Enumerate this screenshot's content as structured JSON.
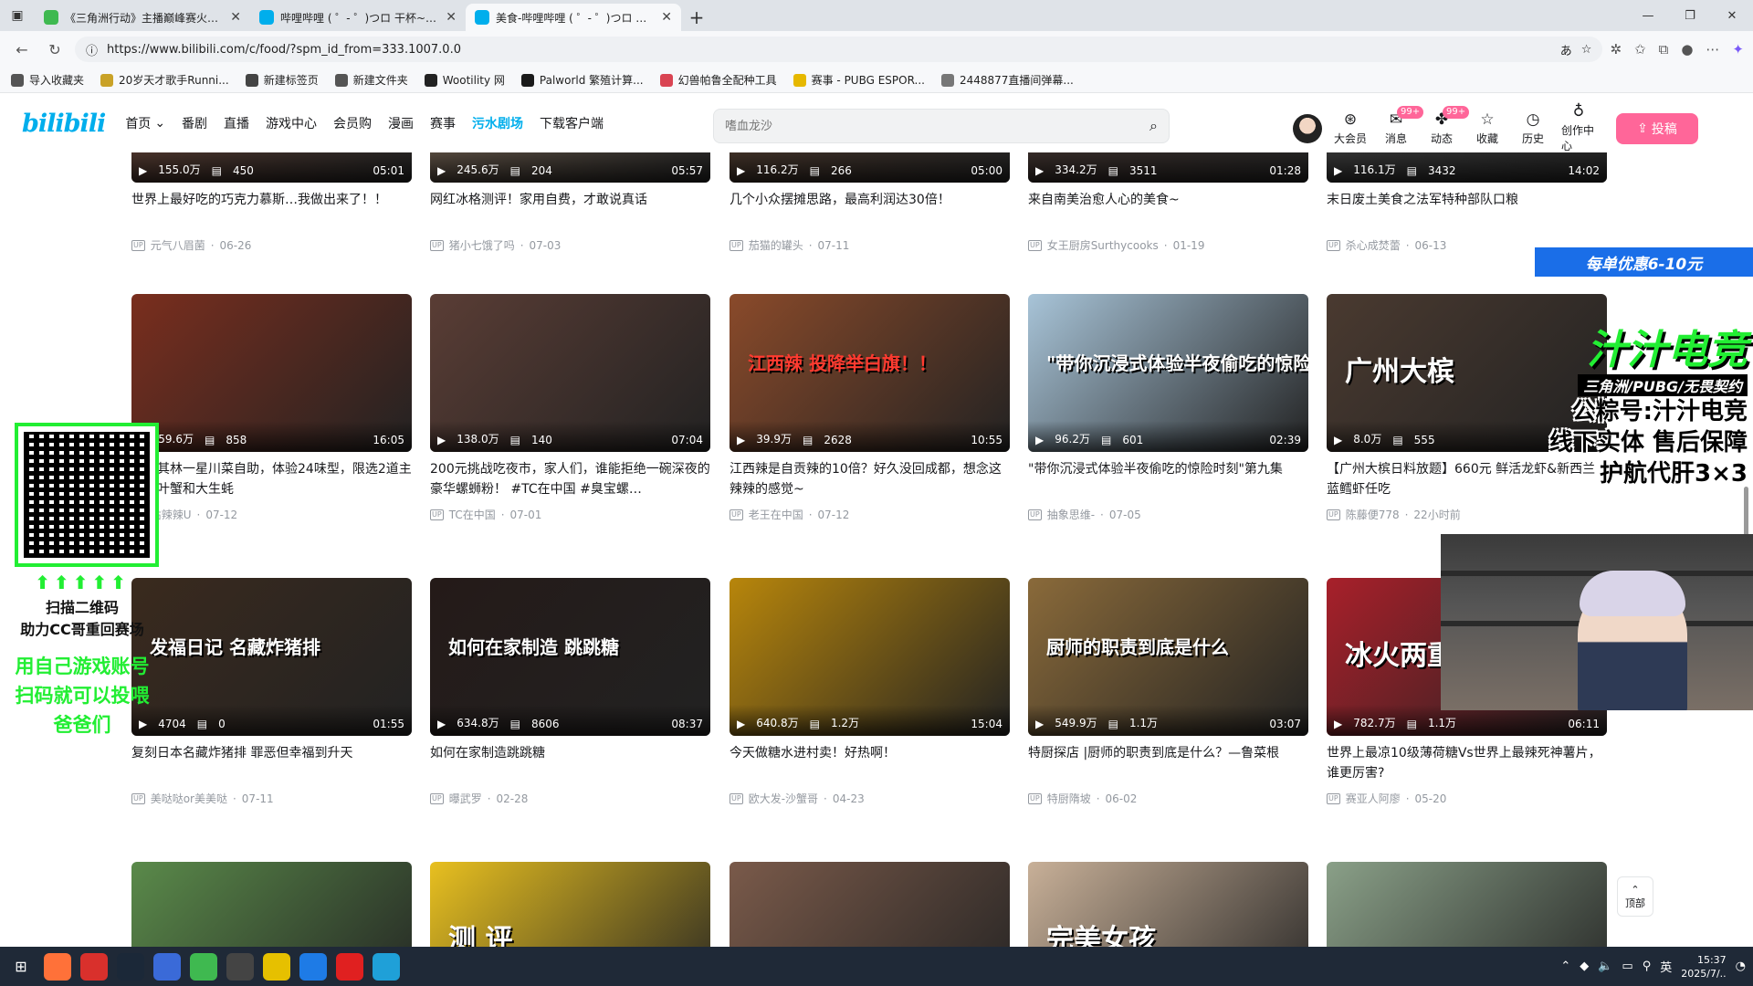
{
  "browser": {
    "tabs": [
      {
        "label": "《三角洲行动》主播巅峰赛火热进行中",
        "icon_color": "#3fb950",
        "active": false
      },
      {
        "label": "哔哩哔哩 ( ゜- ゜)つロ 干杯~-bilibili",
        "icon_color": "#00aeec",
        "active": false
      },
      {
        "label": "美食-哔哩哔哩 ( ゜- ゜)つロ 干杯~",
        "icon_color": "#00aeec",
        "active": true
      }
    ],
    "url": "https://www.bilibili.com/c/food/?spm_id_from=333.1007.0.0",
    "bookmarks": [
      {
        "label": "导入收藏夹",
        "color": "#555555"
      },
      {
        "label": "20岁天才歌手Runni...",
        "color": "#c9a227"
      },
      {
        "label": "新建标签页",
        "color": "#444444"
      },
      {
        "label": "新建文件夹",
        "color": "#555555"
      },
      {
        "label": "Wootility 网",
        "color": "#222222"
      },
      {
        "label": "Palworld 繁殖计算...",
        "color": "#1a1a1a"
      },
      {
        "label": "幻兽帕鲁全配种工具",
        "color": "#d94452"
      },
      {
        "label": "赛事 - PUBG ESPOR...",
        "color": "#e6b800"
      },
      {
        "label": "2448877直播间弹幕...",
        "color": "#777777"
      }
    ]
  },
  "header": {
    "logo": "bilibili",
    "nav": [
      "首页",
      "番剧",
      "直播",
      "游戏中心",
      "会员购",
      "漫画",
      "赛事",
      "污水剧场",
      "下载客户端"
    ],
    "highlight_nav": "污水剧场",
    "search_placeholder": "嗜血龙沙",
    "right_items": [
      {
        "label": "大会员",
        "icon": "vip-icon",
        "glyph": "⊛",
        "badge": ""
      },
      {
        "label": "消息",
        "icon": "message-icon",
        "glyph": "✉",
        "badge": "99+"
      },
      {
        "label": "动态",
        "icon": "dynamic-icon",
        "glyph": "✤",
        "badge": "99+"
      },
      {
        "label": "收藏",
        "icon": "star-icon",
        "glyph": "☆",
        "badge": ""
      },
      {
        "label": "历史",
        "icon": "history-icon",
        "glyph": "◷",
        "badge": ""
      },
      {
        "label": "创作中心",
        "icon": "bulb-icon",
        "glyph": "♁",
        "badge": ""
      }
    ],
    "upload_label": "投稿"
  },
  "rows": [
    [
      {
        "title": "世界上最好吃的巧克力慕斯…我做出来了！！",
        "views": "155.0万",
        "danmaku": "450",
        "duration": "05:01",
        "author": "元气八眉菌",
        "date": "06-26",
        "bg": "#5a3a2e"
      },
      {
        "title": "网红冰格测评！家用自费，才敢说真话",
        "views": "245.6万",
        "danmaku": "204",
        "duration": "05:57",
        "author": "猪小七饿了吗",
        "date": "07-03",
        "bg": "#6b5a4a"
      },
      {
        "title": "几个小众摆摊思路，最高利润达30倍！",
        "views": "116.2万",
        "danmaku": "266",
        "duration": "05:00",
        "author": "茄猫的罐头",
        "date": "07-11",
        "bg": "#4a3528"
      },
      {
        "title": "来自南美治愈人心的美食~",
        "views": "334.2万",
        "danmaku": "3511",
        "duration": "01:28",
        "author": "女王厨房Surthycooks",
        "date": "01-19",
        "bg": "#3e2f2a"
      },
      {
        "title": "末日废土美食之法军特种部队口粮",
        "views": "116.1万",
        "danmaku": "3432",
        "duration": "14:02",
        "author": "杀心成焚蕾",
        "date": "06-13",
        "bg": "#3a3a3a"
      }
    ],
    [
      {
        "title": "元米其林一星川菜自助，体验24味型，限选2道主菜松叶蟹和大生蚝",
        "views": "59.6万",
        "danmaku": "858",
        "duration": "16:05",
        "author": "沾辣辣U",
        "date": "07-12",
        "bg": "#7a2e1e",
        "overlay": ""
      },
      {
        "title": "200元挑战吃夜市，家人们，谁能拒绝一碗深夜的豪华螺蛳粉！ #TC在中国 #臭宝螺…",
        "views": "138.0万",
        "danmaku": "140",
        "duration": "07:04",
        "author": "TC在中国",
        "date": "07-01",
        "bg": "#5a3d35",
        "overlay": ""
      },
      {
        "title": "江西辣是自贡辣的10倍？好久没回成都，想念这辣辣的感觉~",
        "views": "39.9万",
        "danmaku": "2628",
        "duration": "10:55",
        "author": "老王在中国",
        "date": "07-12",
        "bg": "#8a4a2a",
        "overlay": "江西辣 投降举白旗！！"
      },
      {
        "title": "\"带你沉浸式体验半夜偷吃的惊险时刻\"第九集",
        "views": "96.2万",
        "danmaku": "601",
        "duration": "02:39",
        "author": "抽象思维-",
        "date": "07-05",
        "bg": "#a8c4d8",
        "overlay": "\"带你沉浸式体验半夜偷吃的惊险时刻\""
      },
      {
        "title": "【广州大槟日料放题】660元 鲜活龙虾&新西兰蓝鳕虾任吃",
        "views": "8.0万",
        "danmaku": "555",
        "duration": "",
        "author": "陈藤便778",
        "date": "22小时前",
        "bg": "#4a3a30",
        "overlay": "广州大槟"
      }
    ],
    [
      {
        "title": "复刻日本名藏炸猪排 罪恶但幸福到升天",
        "views": "4704",
        "danmaku": "0",
        "duration": "01:55",
        "author": "美哒哒or美美哒",
        "date": "07-11",
        "bg": "#3a2a1e",
        "overlay": "发福日记 名藏炸猪排"
      },
      {
        "title": "如何在家制造跳跳糖",
        "views": "634.8万",
        "danmaku": "8606",
        "duration": "08:37",
        "author": "曝武罗",
        "date": "02-28",
        "bg": "#241a18",
        "overlay": "如何在家制造 跳跳糖"
      },
      {
        "title": "今天做糖水进村卖！好热啊！",
        "views": "640.8万",
        "danmaku": "1.2万",
        "duration": "15:04",
        "author": "欧大发-沙蟹哥",
        "date": "04-23",
        "bg": "#b8860b",
        "overlay": ""
      },
      {
        "title": "特厨探店 |厨师的职责到底是什么？—鲁菜根",
        "views": "549.9万",
        "danmaku": "1.1万",
        "duration": "03:07",
        "author": "特厨隋坡",
        "date": "06-02",
        "bg": "#8a6a3a",
        "overlay": "厨师的职责到底是什么"
      },
      {
        "title": "世界上最凉10级薄荷糖Vs世界上最辣死神薯片，谁更厉害?",
        "views": "782.7万",
        "danmaku": "1.1万",
        "duration": "06:11",
        "author": "赛亚人阿廖",
        "date": "05-20",
        "bg": "#a8202a",
        "overlay": "冰火两重"
      }
    ],
    [
      {
        "title": "",
        "views": "",
        "danmaku": "",
        "duration": "",
        "author": "",
        "date": "",
        "bg": "#5a8a4a",
        "overlay": ""
      },
      {
        "title": "",
        "views": "",
        "danmaku": "",
        "duration": "",
        "author": "",
        "date": "",
        "bg": "#e8c020",
        "overlay": "测 评"
      },
      {
        "title": "",
        "views": "",
        "danmaku": "",
        "duration": "",
        "author": "",
        "date": "",
        "bg": "#7a5a4a",
        "overlay": ""
      },
      {
        "title": "",
        "views": "",
        "danmaku": "",
        "duration": "",
        "author": "",
        "date": "",
        "bg": "#c8b098",
        "overlay": "完美女孩"
      },
      {
        "title": "",
        "views": "",
        "danmaku": "",
        "duration": "",
        "author": "",
        "date": "",
        "bg": "#8aa088",
        "overlay": ""
      }
    ]
  ],
  "scroll_top_label": "顶部",
  "stream_overlay": {
    "promo": "每单优惠6-10元",
    "esports_title": "汁汁电竞",
    "esports_sub": "三角洲/PUBG/无畏契约",
    "lines": [
      "公粽号:汁汁电竞",
      "线下实体 售后保障",
      "护航代肝3×3"
    ],
    "qr_arrows": "⬆⬆⬆⬆⬆",
    "qr_text1": "扫描二维码",
    "qr_text2": "助力CC哥重回赛场",
    "green_lines": [
      "用自己游戏账号",
      "扫码就可以投喂",
      "爸爸们"
    ]
  },
  "taskbar": {
    "time": "15:37",
    "date": "2025/7/..",
    "tray_text": "英",
    "apps": [
      {
        "name": "firefox",
        "color": "#ff7139"
      },
      {
        "name": "wps",
        "color": "#d9302c"
      },
      {
        "name": "steam",
        "color": "#1b2838"
      },
      {
        "name": "app-blue",
        "color": "#3a6ad8"
      },
      {
        "name": "delta-game",
        "color": "#3fb950"
      },
      {
        "name": "obs",
        "color": "#444444"
      },
      {
        "name": "circle-app",
        "color": "#e6c000"
      },
      {
        "name": "wave-app",
        "color": "#1e7be6"
      },
      {
        "name": "netease-music",
        "color": "#e02020"
      },
      {
        "name": "edge",
        "color": "#1fa0d8"
      }
    ]
  }
}
